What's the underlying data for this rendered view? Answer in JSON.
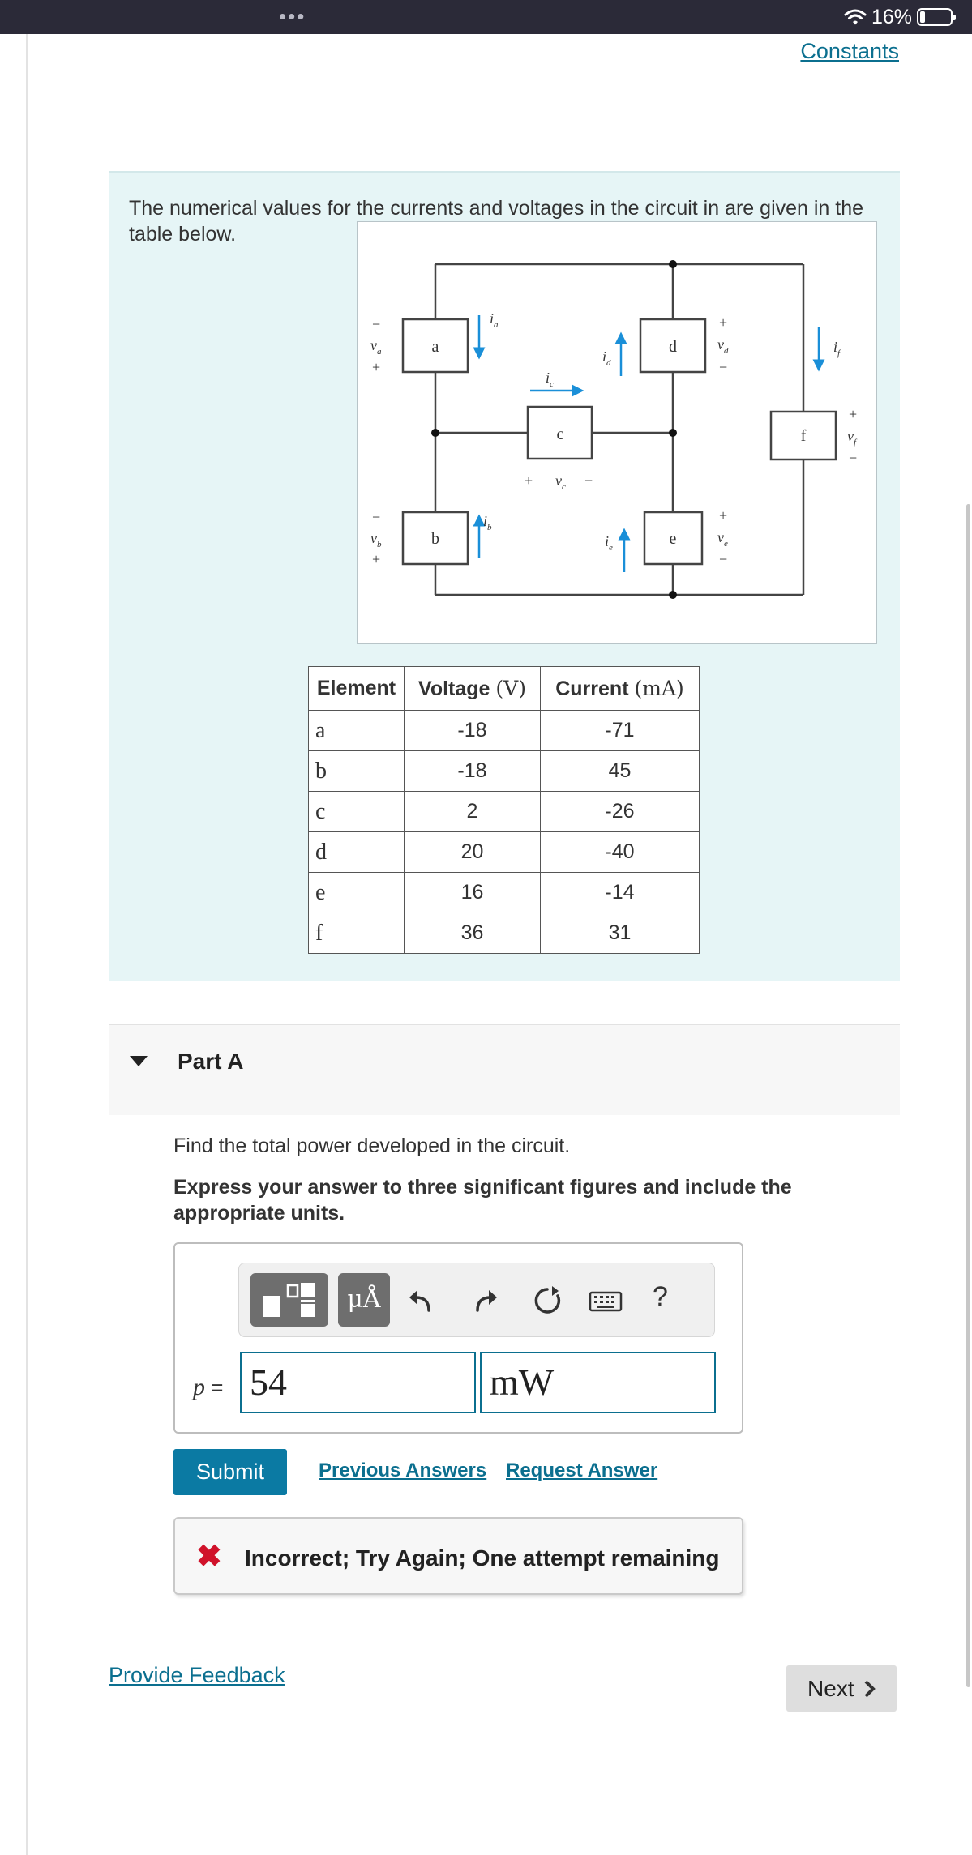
{
  "status_bar": {
    "dots": "•••",
    "battery_text": "16%",
    "battery_level": 0.16,
    "icons": [
      "wifi-icon",
      "battery-icon"
    ]
  },
  "header": {
    "constants_link": "Constants"
  },
  "intro": {
    "text": "The numerical values for the currents and voltages in the circuit in are given in the table below.",
    "figure": {
      "elements": [
        "a",
        "b",
        "c",
        "d",
        "e",
        "f"
      ],
      "voltage_labels": [
        "v",
        "a",
        "b",
        "c",
        "d",
        "e",
        "f"
      ],
      "current_labels": [
        "i"
      ],
      "plus": "+",
      "minus": "−"
    }
  },
  "table": {
    "headers": [
      "Element",
      "Voltage",
      "(V)",
      "Current",
      "(mA)"
    ],
    "rows": [
      [
        "a",
        "-18",
        "-71"
      ],
      [
        "b",
        "-18",
        "45"
      ],
      [
        "c",
        "2",
        "-26"
      ],
      [
        "d",
        "20",
        "-40"
      ],
      [
        "e",
        "16",
        "-14"
      ],
      [
        "f",
        "36",
        "31"
      ]
    ]
  },
  "part_a": {
    "title": "Part A",
    "question": "Find the total power developed in the circuit.",
    "instructions": "Express your answer to three significant figures and include the appropriate units.",
    "toolbar": {
      "units_label": "μÅ",
      "help_label": "?",
      "icons": [
        "templates-icon",
        "units-icon",
        "undo-icon",
        "redo-icon",
        "reset-icon",
        "keyboard-icon",
        "help-icon"
      ]
    },
    "variable": "p",
    "equals": "=",
    "answer_value": "54",
    "answer_unit": "mW",
    "submit_label": "Submit",
    "previous_answers_label": "Previous Answers",
    "request_answer_label": "Request Answer",
    "feedback_icon": "incorrect-x-icon",
    "feedback_symbol": "✖",
    "feedback_text": "Incorrect; Try Again; One attempt remaining"
  },
  "footer": {
    "provide_feedback": "Provide Feedback",
    "next_label": "Next",
    "next_icon": "chevron-right-icon"
  },
  "colors": {
    "status_bar": "#2b2a38",
    "intro_bg": "#e6f5f6",
    "link": "#0b6f8f",
    "submit": "#0b7aa3",
    "error": "#d0122a",
    "current_arrow": "#1a8fd8"
  }
}
